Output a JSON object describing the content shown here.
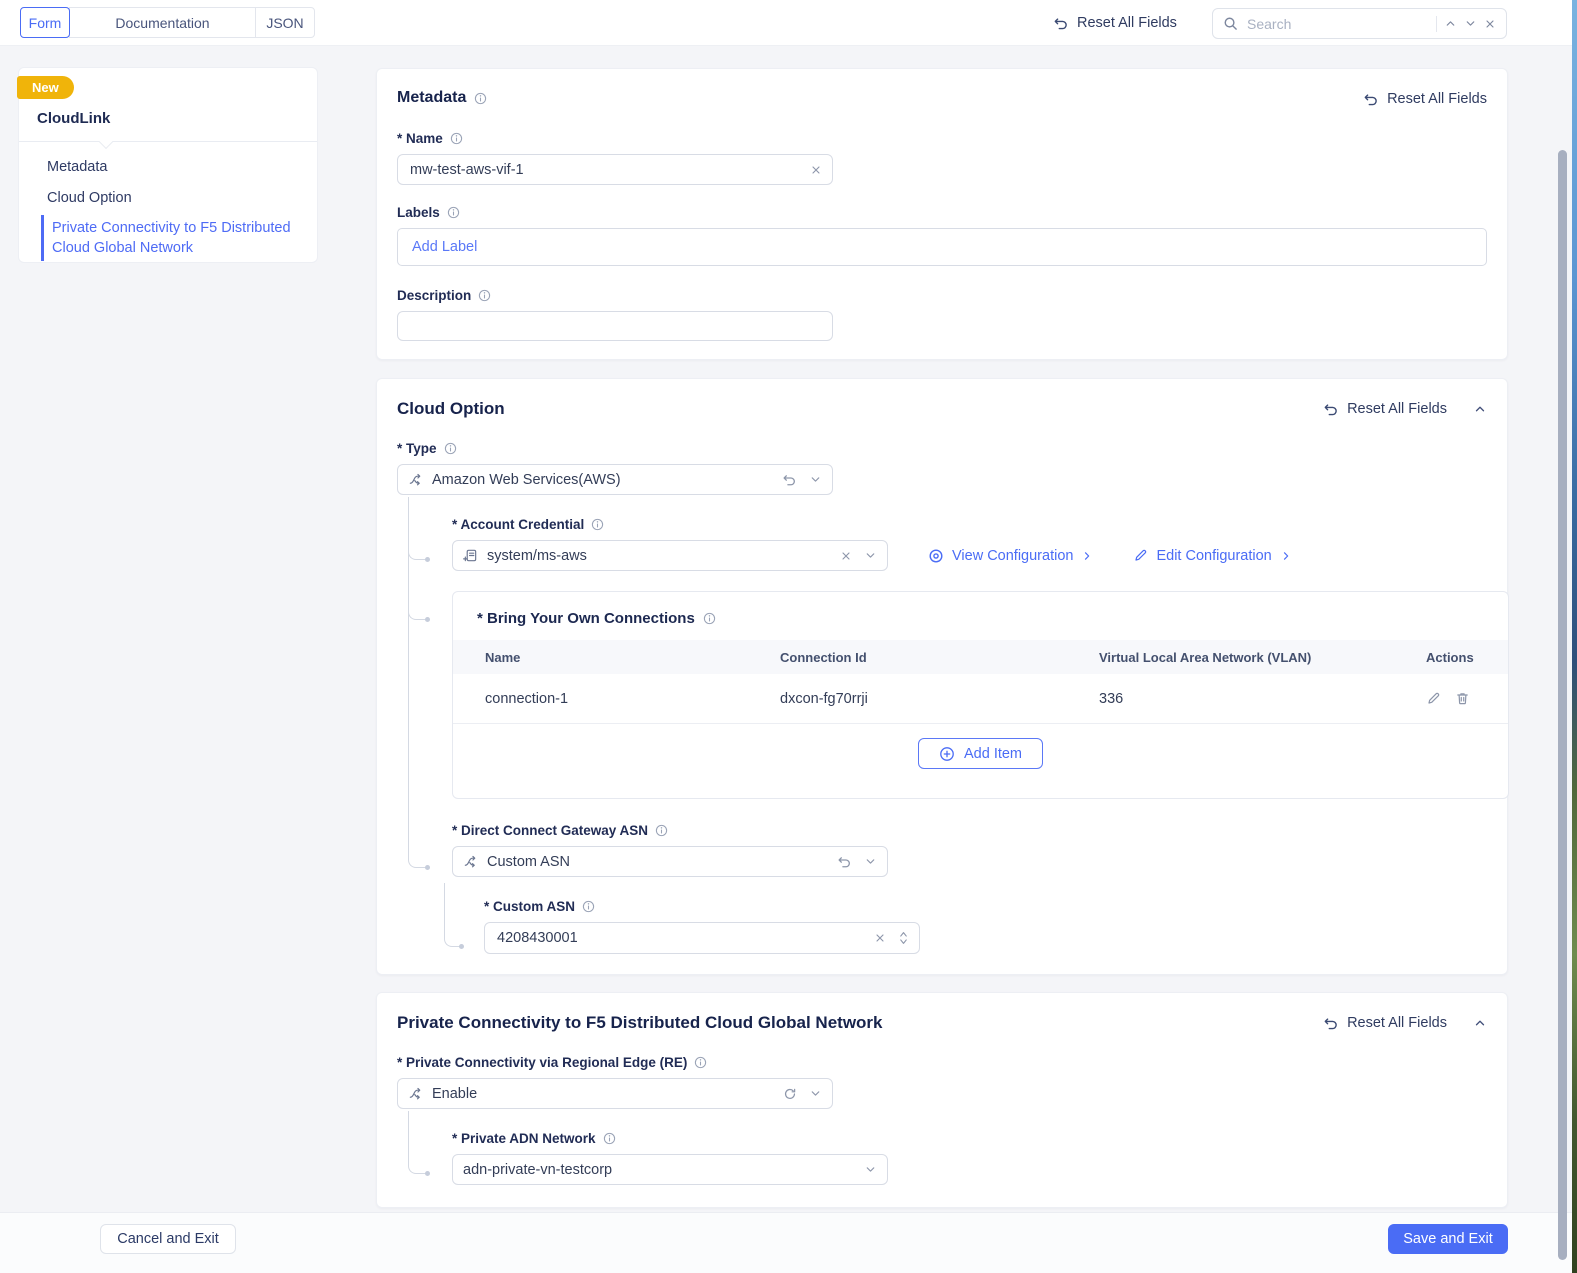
{
  "ui": {
    "reset_all_label": "Reset All Fields",
    "search_placeholder": "Search"
  },
  "topbar": {
    "tabs": [
      {
        "label": "Form",
        "active": true
      },
      {
        "label": "Documentation",
        "active": false
      },
      {
        "label": "JSON",
        "active": false
      }
    ]
  },
  "sidebar": {
    "badge": "New",
    "title": "CloudLink",
    "items": [
      {
        "label": "Metadata",
        "active": false
      },
      {
        "label": "Cloud Option",
        "active": false
      },
      {
        "label": "Private Connectivity to F5 Distributed Cloud Global Network",
        "active": true
      }
    ]
  },
  "metadata": {
    "title": "Metadata",
    "name_label": "* Name",
    "name_value": "mw-test-aws-vif-1",
    "labels_label": "Labels",
    "labels_placeholder": "Add Label",
    "description_label": "Description",
    "description_value": ""
  },
  "cloud_option": {
    "title": "Cloud Option",
    "type_label": "* Type",
    "type_value": "Amazon Web Services(AWS)",
    "account_credential_label": "* Account Credential",
    "account_credential_value": "system/ms-aws",
    "view_configuration_label": "View Configuration",
    "edit_configuration_label": "Edit Configuration",
    "byoc": {
      "title": "* Bring Your Own Connections",
      "columns": [
        "Name",
        "Connection Id",
        "Virtual Local Area Network (VLAN)",
        "Actions"
      ],
      "rows": [
        {
          "name": "connection-1",
          "connection_id": "dxcon-fg70rrji",
          "vlan": "336"
        }
      ],
      "add_item_label": "Add Item"
    },
    "dcg_asn_label": "* Direct Connect Gateway ASN",
    "dcg_asn_value": "Custom ASN",
    "custom_asn_label": "* Custom ASN",
    "custom_asn_value": "4208430001"
  },
  "private_connectivity": {
    "title": "Private Connectivity to F5 Distributed Cloud Global Network",
    "re_label": "* Private Connectivity via Regional Edge (RE)",
    "re_value": "Enable",
    "adn_label": "* Private ADN Network",
    "adn_value": "adn-private-vn-testcorp"
  },
  "footer": {
    "cancel_label": "Cancel and Exit",
    "save_label": "Save and Exit"
  },
  "icons": {
    "search": "magnifier",
    "reset": "undo-curved-arrow",
    "refresh": "circular-arrow",
    "info": "circled-i",
    "oneof_selector": "split-path-arrow",
    "credential_ref": "document-with-plus",
    "view": "concentric-eye",
    "edit": "pencil",
    "delete": "trash-can",
    "add": "plus-in-circle",
    "collapse": "chevron-up",
    "dropdown": "chevron-down",
    "clear": "x-mark"
  },
  "colors": {
    "accent": "#4a6cf5",
    "badge": "#f0b40a",
    "heading": "#17234c",
    "page_bg": "#f4f5f8"
  }
}
